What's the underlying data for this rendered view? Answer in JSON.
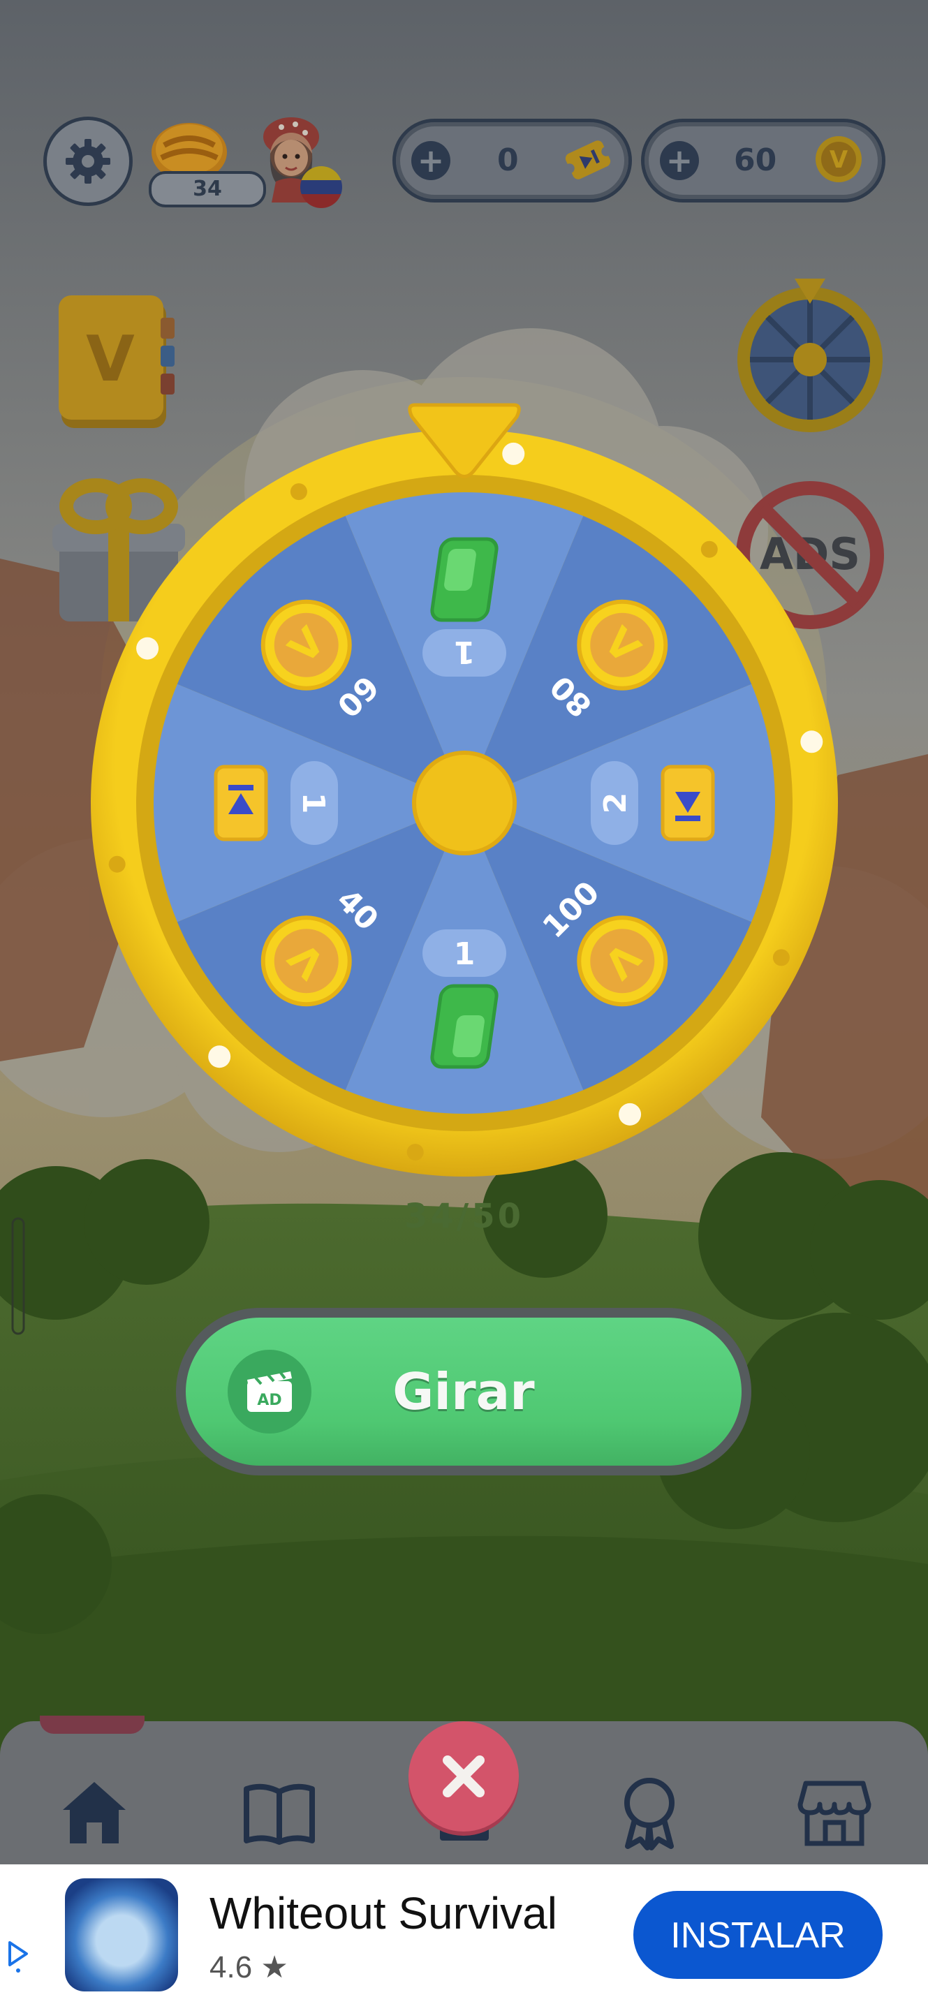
{
  "hud": {
    "level": "34",
    "tickets": "0",
    "coins": "60",
    "icons": [
      "settings-gear-icon",
      "level-medal-icon",
      "avatar-icon",
      "venezuela-flag-icon",
      "ticket-icon",
      "coin-icon"
    ]
  },
  "side_icons": [
    "album-book-icon",
    "gift-icon",
    "lucky-wheel-icon",
    "no-ads-icon"
  ],
  "no_ads_label": "ADS",
  "wheel": {
    "segments": [
      {
        "reward": "gem",
        "amount": "1"
      },
      {
        "reward": "coin",
        "amount": "80"
      },
      {
        "reward": "ticket",
        "amount": "2"
      },
      {
        "reward": "coin",
        "amount": "100"
      },
      {
        "reward": "gem",
        "amount": "1"
      },
      {
        "reward": "coin",
        "amount": "40"
      },
      {
        "reward": "ticket",
        "amount": "1"
      },
      {
        "reward": "coin",
        "amount": "60"
      }
    ],
    "coin_letter": "V"
  },
  "spin_counter": "34/50",
  "spin_button": {
    "label": "Girar",
    "ad_badge": "AD"
  },
  "nav": {
    "items": [
      "home-icon",
      "book-icon",
      "leaderboard-icon",
      "award-ribbon-icon",
      "shop-icon"
    ],
    "close": "close-icon"
  },
  "ad_banner": {
    "app_name": "Whiteout Survival",
    "rating": "4.6 ★",
    "install_label": "INSTALAR"
  },
  "colors": {
    "wheel_gold": "#f2c818",
    "wheel_blue_light": "#6d95d6",
    "wheel_blue_dark": "#5981c6",
    "spin_green": "#4fc872",
    "install_blue": "#0b57d0"
  }
}
